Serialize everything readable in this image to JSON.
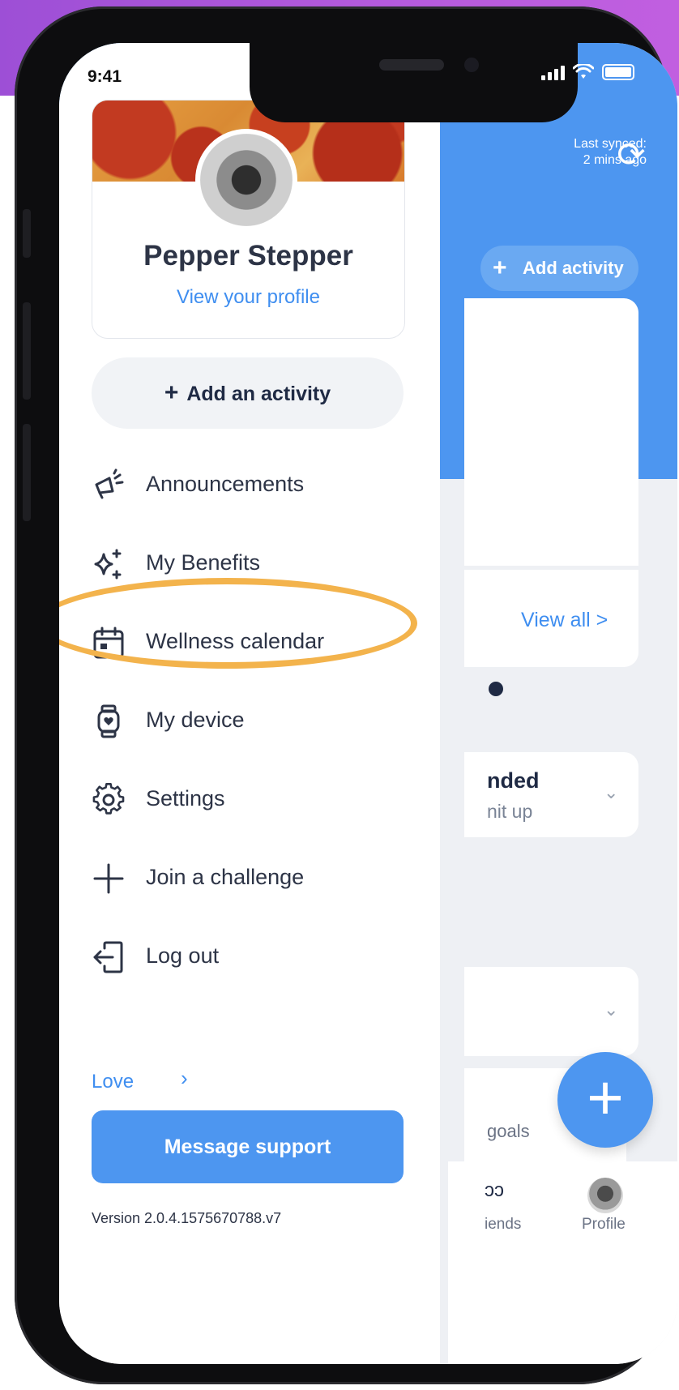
{
  "status_bar": {
    "time": "9:41"
  },
  "drawer": {
    "profile": {
      "name": "Pepper Stepper",
      "link": "View your profile"
    },
    "add_activity_label": "Add an activity",
    "menu": [
      {
        "label": "Announcements",
        "icon": "megaphone-icon"
      },
      {
        "label": "My Benefits",
        "icon": "sparkle-icon"
      },
      {
        "label": "Wellness calendar",
        "icon": "calendar-icon"
      },
      {
        "label": "My device",
        "icon": "smartwatch-icon"
      },
      {
        "label": "Settings",
        "icon": "gear-icon"
      },
      {
        "label": "Join a challenge",
        "icon": "plus-icon"
      },
      {
        "label": "Log out",
        "icon": "logout-icon"
      }
    ],
    "love_label": "Love",
    "support_button": "Message support",
    "version": "Version 2.0.4.1575670788.v7"
  },
  "background_app": {
    "sync_line1": "Last synced:",
    "sync_line2": "2 mins ago",
    "add_activity": "Add activity",
    "view_all": "View all >",
    "card_title_partial": "nded",
    "card_subtitle_partial": "nit up",
    "goals_partial": "goals",
    "tab_friends_partial": "iends",
    "tab_profile": "Profile"
  },
  "colors": {
    "brand_blue": "#4d96f0",
    "link_blue": "#3f8ef0",
    "highlight_orange": "#f3b34c",
    "text_dark": "#2d3446",
    "backdrop_purple": "#b55bdc"
  }
}
